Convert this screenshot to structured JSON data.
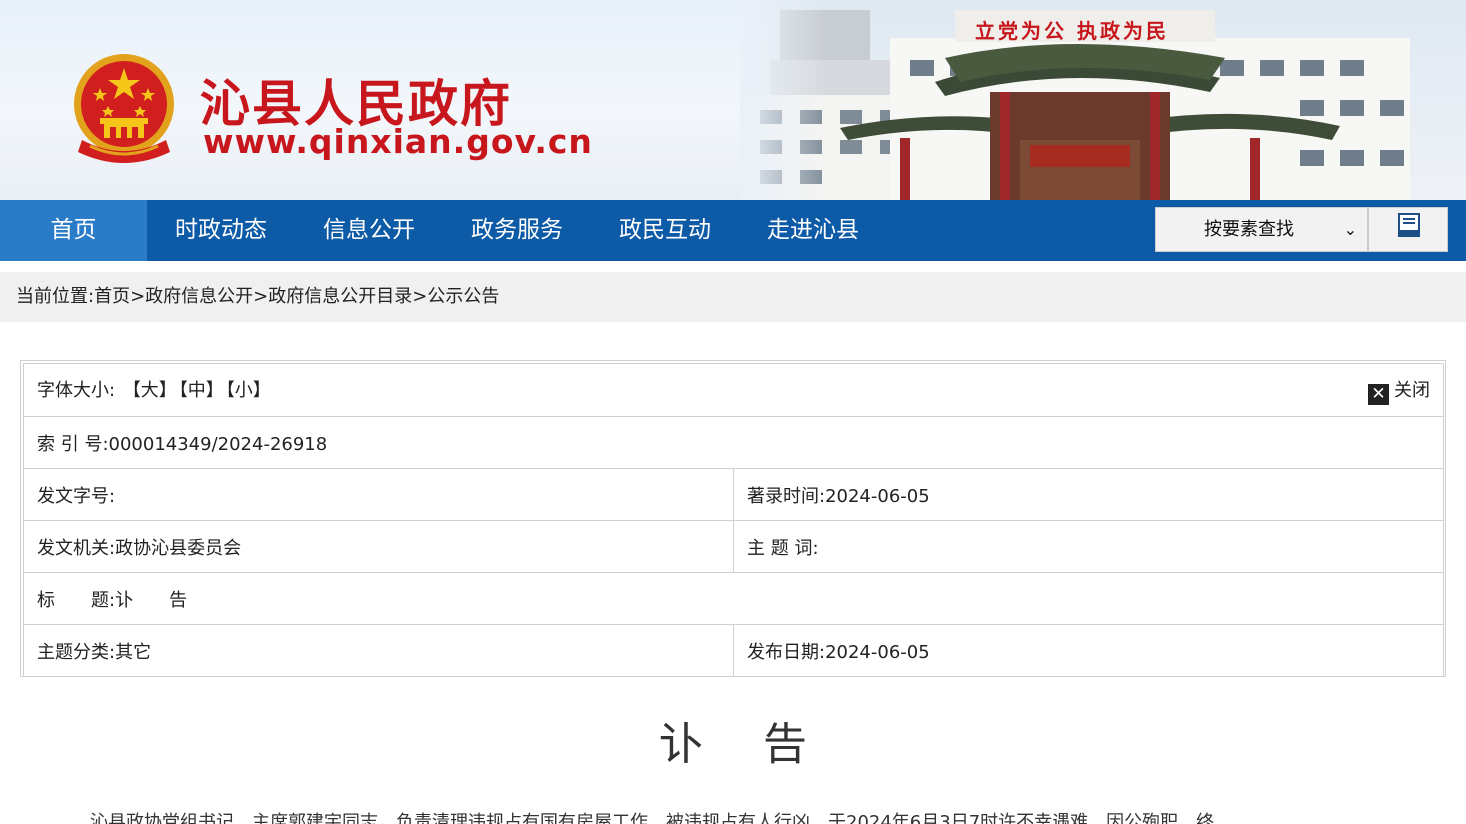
{
  "header": {
    "site_name": "沁县人民政府",
    "site_url": "www.qinxian.gov.cn",
    "slogan": "立党为公 执政为民",
    "colors": {
      "brand_red": "#c8161d",
      "nav_blue": "#0d5aa7",
      "nav_active": "#2a7bc8"
    }
  },
  "nav": {
    "items": [
      {
        "label": "首页"
      },
      {
        "label": "时政动态"
      },
      {
        "label": "信息公开"
      },
      {
        "label": "政务服务"
      },
      {
        "label": "政民互动"
      },
      {
        "label": "走进沁县"
      }
    ],
    "search_select": "按要素查找",
    "search_icon": "search-icon"
  },
  "breadcrumb": {
    "prefix": "当前位置:",
    "path": "首页>政府信息公开>政府信息公开目录>公示公告"
  },
  "meta": {
    "font_size_label": "字体大小:",
    "font_large": "【大】",
    "font_medium": "【中】",
    "font_small": "【小】",
    "close_label": "关闭",
    "index_label": "索 引 号:",
    "index_value": "000014349/2024-26918",
    "doc_no_label": "发文字号:",
    "doc_no_value": "",
    "record_time_label": "著录时间:",
    "record_time_value": "2024-06-05",
    "issuer_label": "发文机关:",
    "issuer_value": "政协沁县委员会",
    "keywords_label": "主 题 词:",
    "keywords_value": "",
    "title_label": "标　　题:",
    "title_value": "讣　　告",
    "category_label": "主题分类:",
    "category_value": "其它",
    "publish_date_label": "发布日期:",
    "publish_date_value": "2024-06-05"
  },
  "article": {
    "title": "讣告",
    "body_first_line": "沁县政协党组书记、主席郭建宇同志，负责清理违规占有国有房屋工作，被违规占有人行凶，于2024年6月3日7时许不幸遇难，因公殉职，终"
  }
}
